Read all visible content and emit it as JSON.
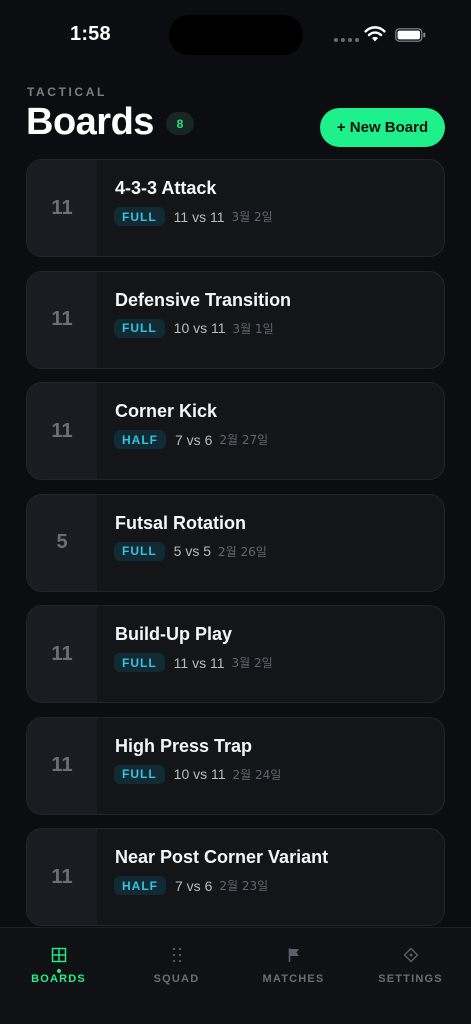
{
  "status_bar": {
    "time": "1:58"
  },
  "header": {
    "section_label": "TACTICAL",
    "title": "Boards",
    "count": "8",
    "new_board_label": "+ New Board"
  },
  "boards": [
    {
      "count": "11",
      "title": "4-3-3 Attack",
      "field": "FULL",
      "matchup": "11 vs 11",
      "date": "3월 2일"
    },
    {
      "count": "11",
      "title": "Defensive Transition",
      "field": "FULL",
      "matchup": "10 vs 11",
      "date": "3월 1일"
    },
    {
      "count": "11",
      "title": "Corner Kick",
      "field": "HALF",
      "matchup": "7 vs 6",
      "date": "2월 27일"
    },
    {
      "count": "5",
      "title": "Futsal Rotation",
      "field": "FULL",
      "matchup": "5 vs 5",
      "date": "2월 26일"
    },
    {
      "count": "11",
      "title": "Build-Up Play",
      "field": "FULL",
      "matchup": "11 vs 11",
      "date": "3월 2일"
    },
    {
      "count": "11",
      "title": "High Press Trap",
      "field": "FULL",
      "matchup": "10 vs 11",
      "date": "2월 24일"
    },
    {
      "count": "11",
      "title": "Near Post Corner Variant",
      "field": "HALF",
      "matchup": "7 vs 6",
      "date": "2월 23일"
    }
  ],
  "tabs": [
    {
      "label": "BOARDS",
      "icon": "grid-icon",
      "active": true
    },
    {
      "label": "SQUAD",
      "icon": "dots-icon",
      "active": false
    },
    {
      "label": "MATCHES",
      "icon": "flag-icon",
      "active": false
    },
    {
      "label": "SETTINGS",
      "icon": "diamond-icon",
      "active": false
    }
  ],
  "colors": {
    "accent": "#1ef08c",
    "badge_text": "#37c3e2",
    "background": "#0c0d10"
  }
}
